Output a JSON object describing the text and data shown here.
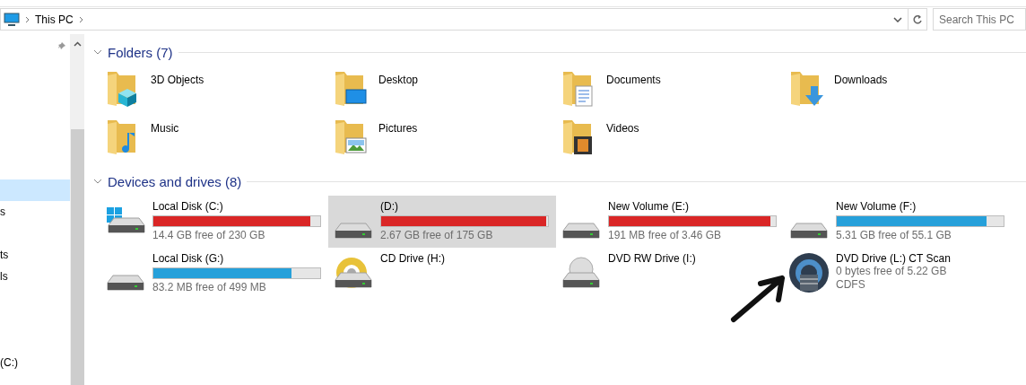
{
  "address_bar": {
    "crumbs": [
      "This PC"
    ]
  },
  "search": {
    "placeholder": "Search This PC"
  },
  "sidebar": {
    "items": [
      {
        "selected": true
      },
      {
        "label": "s",
        "selected": false
      },
      {
        "label": "ts",
        "selected": false
      },
      {
        "label": "ls",
        "selected": false
      },
      {
        "label": "(C:)",
        "selected": false
      }
    ]
  },
  "sections": [
    {
      "title": "Folders (7)",
      "expanded": true,
      "kind": "folders",
      "items": [
        {
          "name": "3D Objects"
        },
        {
          "name": "Desktop"
        },
        {
          "name": "Documents"
        },
        {
          "name": "Downloads"
        },
        {
          "name": "Music"
        },
        {
          "name": "Pictures"
        },
        {
          "name": "Videos"
        }
      ]
    },
    {
      "title": "Devices and drives (8)",
      "expanded": true,
      "kind": "drives",
      "items": [
        {
          "name": "Local Disk (C:)",
          "kind": "volume",
          "level": 0.94,
          "low_space": true,
          "free": "14.4 GB free of 230 GB",
          "selected": false
        },
        {
          "name": "(D:)",
          "kind": "volume",
          "level": 0.99,
          "low_space": true,
          "free": "2.67 GB free of 175 GB",
          "selected": true
        },
        {
          "name": "New Volume (E:)",
          "kind": "volume",
          "level": 0.97,
          "low_space": true,
          "free": "191 MB free of 3.46 GB",
          "selected": false
        },
        {
          "name": "New Volume (F:)",
          "kind": "volume",
          "level": 0.9,
          "low_space": false,
          "free": "5.31 GB free of 55.1 GB",
          "selected": false
        },
        {
          "name": "Local Disk (G:)",
          "kind": "volume",
          "level": 0.83,
          "low_space": false,
          "free": "83.2 MB free of 499 MB",
          "selected": false
        },
        {
          "name": "CD Drive (H:)",
          "kind": "optical",
          "selected": false
        },
        {
          "name": "DVD RW Drive (I:)",
          "kind": "optical",
          "selected": false
        },
        {
          "name": "DVD Drive (L:) CT Scan",
          "kind": "disc",
          "free": "0 bytes free of 5.22 GB",
          "filesystem": "CDFS",
          "selected": false
        }
      ]
    }
  ]
}
